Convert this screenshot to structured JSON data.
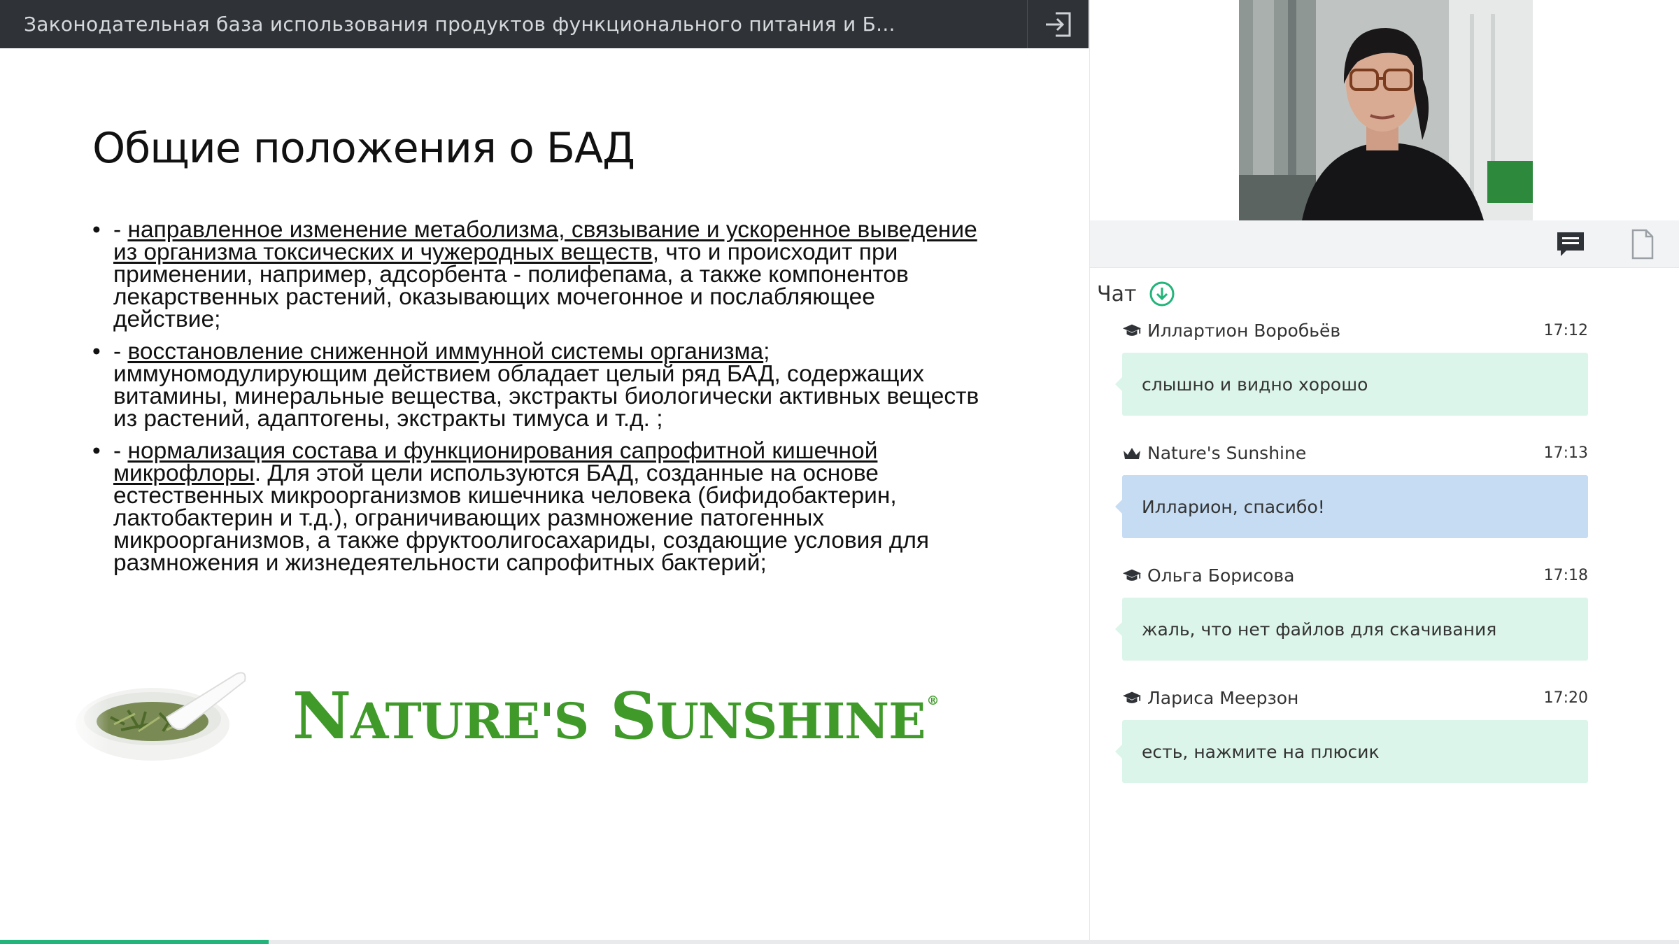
{
  "header": {
    "title": "Законодательная база использования продуктов функционального питания и Б..."
  },
  "slide": {
    "title": "Общие положения о БАД",
    "bullets": [
      {
        "prefix": "- ",
        "underlined": "направленное изменение метаболизма, связывание и ускоренное выведение из организма токсических и чужеродных веществ",
        "rest": ", что и происходит при применении, например, адсорбента - полифепама, а также компонентов лекарственных растений, оказывающих мочегонное и послабляющее действие;"
      },
      {
        "prefix": "- ",
        "underlined": "восстановление сниженной иммунной системы организма",
        "rest": "; иммуномодулирующим действием обладает целый ряд БАД, содержащих витамины, минеральные вещества, экстракты биологически активных веществ из растений, адаптогены, экстракты тимуса и т.д. ;"
      },
      {
        "prefix": "- ",
        "underlined": "нормализация состава и функционирования сапрофитной кишечной микрофлоры",
        "rest": ". Для этой цели используются БАД, созданные на основе естественных микроорганизмов кишечника человека (бифидобактерин, лактобактерин и т.д.), ограничивающих размножение патогенных микроорганизмов, а также фруктоолигосахариды, создающие условия для размножения и жизнедеятельности сапрофитных бактерий;"
      }
    ],
    "logo": {
      "n": "N",
      "atures": "ATURE'S",
      "s": "S",
      "unshine": "UNSHINE",
      "reg": "®"
    }
  },
  "chat": {
    "label": "Чат",
    "messages": [
      {
        "author": "Иллартион Воробьёв",
        "time": "17:12",
        "text": "слышно и видно хорошо",
        "role": "student",
        "style": "green"
      },
      {
        "author": "Nature's Sunshine",
        "time": "17:13",
        "text": "Илларион, спасибо!",
        "role": "host",
        "style": "blue"
      },
      {
        "author": "Ольга Борисова",
        "time": "17:18",
        "text": "жаль, что нет файлов для скачивания",
        "role": "student",
        "style": "green"
      },
      {
        "author": "Лариса Меерзон",
        "time": "17:20",
        "text": "есть, нажмите на плюсик",
        "role": "student",
        "style": "green"
      }
    ]
  },
  "icons": {
    "exit": "exit-icon",
    "chat": "chat-icon",
    "file": "file-icon",
    "download": "download-icon",
    "student": "graduation-cap-icon",
    "host": "crown-icon"
  },
  "colors": {
    "topbar": "#2f3338",
    "accent": "#22b47a",
    "logo_green": "#3f9a2a",
    "bubble_green": "#dcf5ea",
    "bubble_blue": "#c5dcf3"
  },
  "progress": {
    "fraction": 0.16
  }
}
